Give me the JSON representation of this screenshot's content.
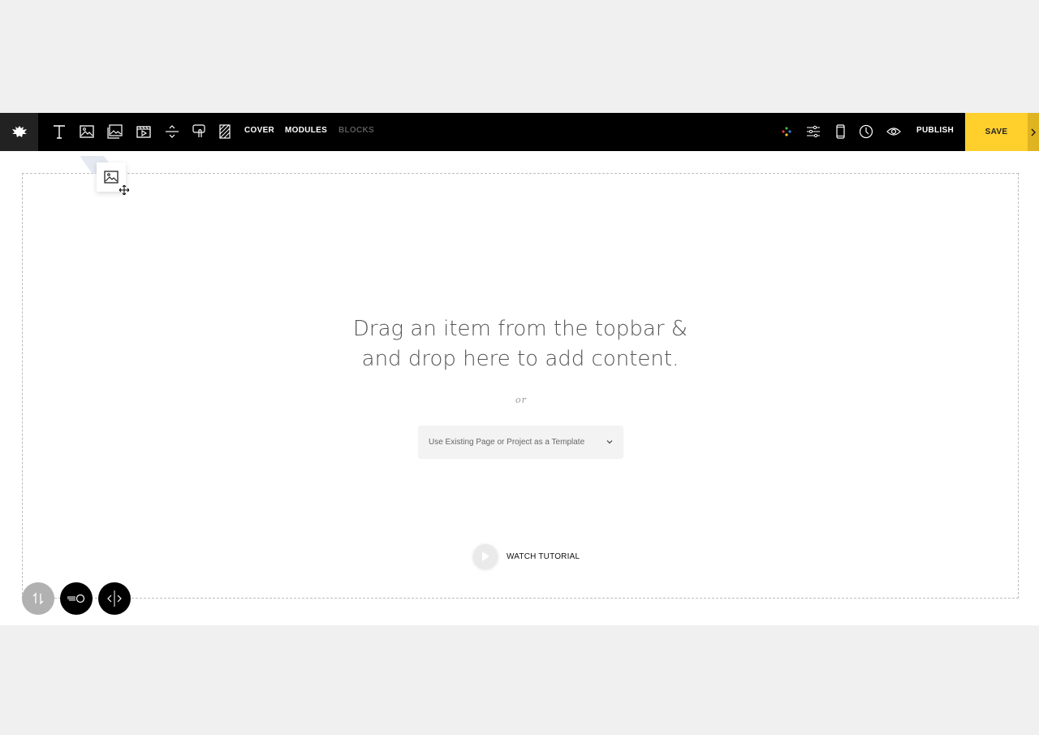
{
  "toolbar": {
    "tools": [
      "text-tool",
      "image-tool",
      "gallery-tool",
      "video-tool",
      "spacer-tool",
      "button-tool",
      "pattern-tool"
    ],
    "cover_label": "COVER",
    "modules_label": "MODULES",
    "blocks_label": "BLOCKS",
    "right_icons": [
      "color-palette-icon",
      "settings-sliders-icon",
      "mobile-icon",
      "clock-icon",
      "eye-icon"
    ],
    "publish_label": "PUBLISH",
    "save_label": "SAVE"
  },
  "canvas": {
    "headline_line1": "Drag an item from the topbar &",
    "headline_line2": "and drop here to add content.",
    "or_label": "or",
    "template_select": "Use Existing Page or Project as a Template",
    "watch_tutorial": "WATCH TUTORIAL"
  },
  "colors": {
    "topbar": "#000000",
    "save_accent": "#ffcf2c",
    "canvas_bg": "#ffffff",
    "page_bg": "#f0f0f0"
  }
}
